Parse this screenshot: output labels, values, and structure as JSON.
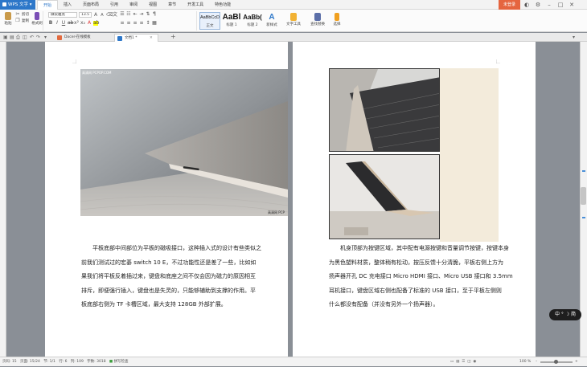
{
  "title_bar": {
    "app_name": "WPS 文字",
    "menu_tabs": [
      "开始",
      "插入",
      "页面布局",
      "引用",
      "审阅",
      "视图",
      "章节",
      "开发工具",
      "特色功能"
    ],
    "active_tab": "开始",
    "login_label": "未登录",
    "window_controls": [
      "minimize-icon",
      "restore-icon",
      "close-icon"
    ]
  },
  "ribbon": {
    "clipboard": {
      "paste_label": "粘贴",
      "cut_label": "剪切",
      "copy_label": "复制",
      "format_painter_label": "格式刷"
    },
    "font": {
      "font_name": "微软雅黑",
      "font_size": "13.5",
      "bold": "B",
      "italic": "I",
      "underline": "U"
    },
    "styles": [
      {
        "sample": "AaBbCcDd",
        "label": "正文"
      },
      {
        "sample": "AaBl",
        "label": "标题 1"
      },
      {
        "sample": "AaBb(",
        "label": "标题 2"
      },
      {
        "sample": "A",
        "label": "新样式"
      }
    ],
    "text_tools_label": "文字工具",
    "find_replace_label": "查找替换",
    "select_label": "选择"
  },
  "tab_bar": {
    "tabs": [
      {
        "label": "Docer-在线模板",
        "active": false
      },
      {
        "label": "文档1 *",
        "active": true
      }
    ],
    "new_tab_label": "+"
  },
  "document": {
    "left_page": {
      "photo_watermark_top": "高清网  PCPOP.COM",
      "photo_watermark_bottom": "高清网  PCP",
      "paragraph": [
        "平板底部中间部位为平板的磁吸接口，这种插入式的设计有些类似之",
        "前我们测试过的宏碁 switch 10 E，不过功能性还是差了一些，比如如",
        "果我们将平板反着插过来，键盘和底座之间不仅会因为磁力的原因相互",
        "排斥，即便强行插入，键盘也是失灵的，只能够辅助到支撑的作用。平",
        "板底部右侧为 TF 卡槽区域，最大支持 128GB 外部扩展。"
      ]
    },
    "right_page": {
      "paragraph": [
        "机身顶部为按键区域，其中配有电源按键和音量调节按键，按键本身",
        "为黑色塑料材质，整体稍有松动，按压反馈十分清脆，平板右侧上方为",
        "扬声器开孔 DC 充电接口 Micro HDMI 接口、Micro USB 接口和 3.5mm",
        "耳机接口，键盘区域右侧也配备了标准的 USB 接口，至于平板左侧则",
        "什么都没有配备（并没有另外一个扬声器）。"
      ]
    }
  },
  "status_bar": {
    "page": "页码: 15",
    "pages": "页面: 15/24",
    "section": "节: 1/1",
    "row": "行: 6",
    "column": "列: 109",
    "word_count": "字数: 3018",
    "spell_check": "拼写检查",
    "zoom": "100 %"
  },
  "ime_indicator": "中 ° ☽ 简"
}
